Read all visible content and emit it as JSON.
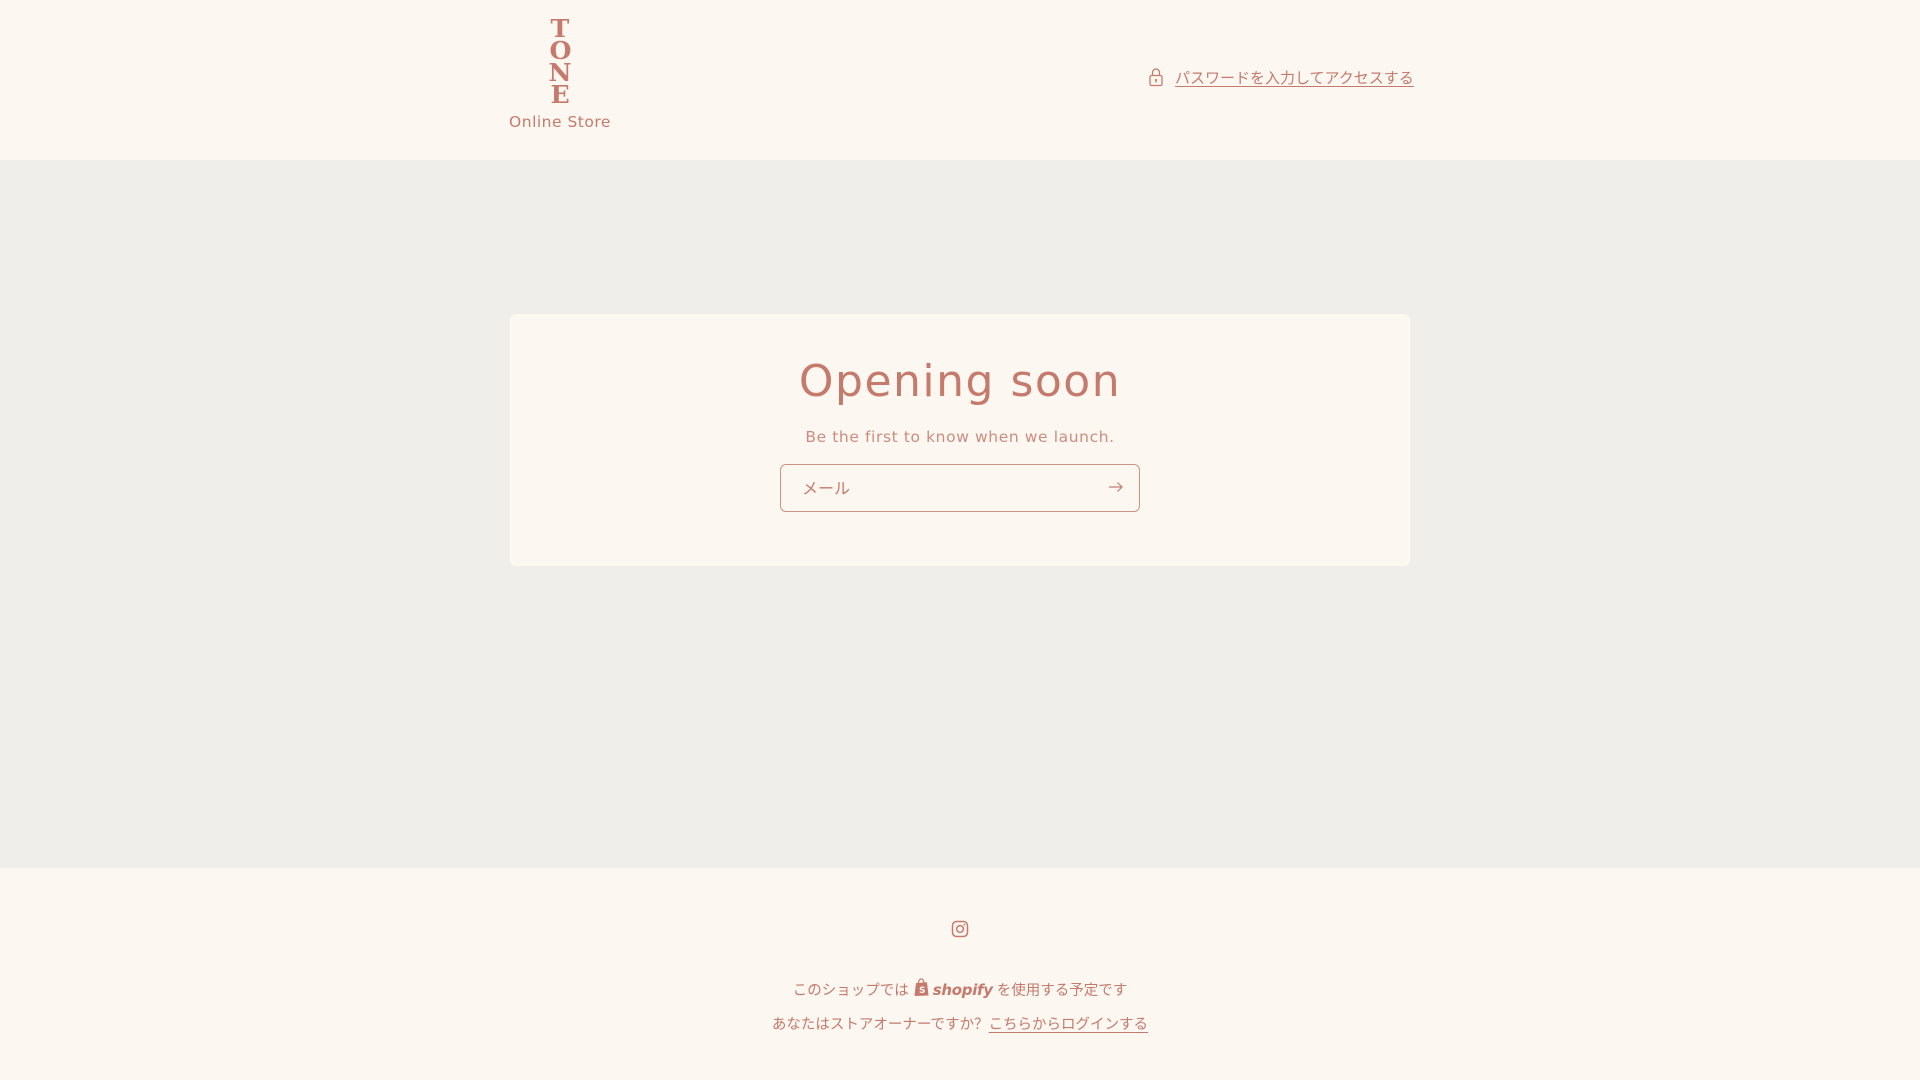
{
  "brand": {
    "logo_letters": [
      "T",
      "O",
      "N",
      "E"
    ],
    "logo_subtitle": "Online Store",
    "color": "#c57a6c"
  },
  "header": {
    "password_link_label": "パスワードを入力してアクセスする",
    "password_icon": "lock-icon"
  },
  "main": {
    "title": "Opening soon",
    "subtitle": "Be the first to know when we launch.",
    "email_placeholder": "メール",
    "submit_icon": "arrow-right-icon"
  },
  "footer": {
    "social_icon": "instagram-icon",
    "powered_prefix": "このショップでは",
    "shopify_label": "shopify",
    "powered_suffix": "を使用する予定です",
    "owner_question": "あなたはストアオーナーですか？",
    "login_link_label": "こちらからログインする"
  },
  "colors": {
    "page_background": "#fdf7f1",
    "band_background": "#efeeeb",
    "accent": "#c57a6c"
  }
}
